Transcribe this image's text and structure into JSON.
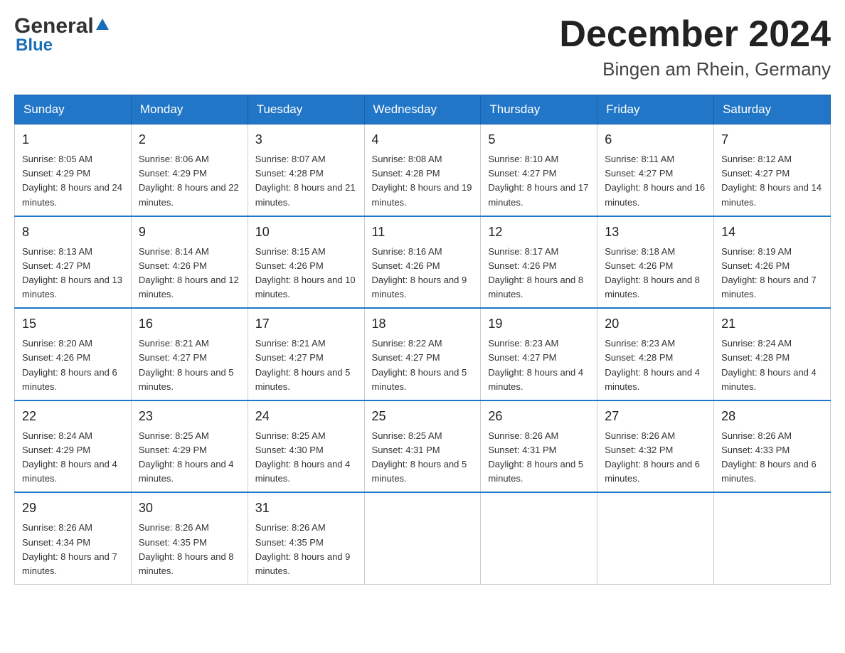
{
  "header": {
    "logo_general": "General",
    "logo_blue": "Blue",
    "title": "December 2024",
    "subtitle": "Bingen am Rhein, Germany"
  },
  "days_of_week": [
    "Sunday",
    "Monday",
    "Tuesday",
    "Wednesday",
    "Thursday",
    "Friday",
    "Saturday"
  ],
  "weeks": [
    [
      {
        "day": "1",
        "sunrise": "Sunrise: 8:05 AM",
        "sunset": "Sunset: 4:29 PM",
        "daylight": "Daylight: 8 hours and 24 minutes."
      },
      {
        "day": "2",
        "sunrise": "Sunrise: 8:06 AM",
        "sunset": "Sunset: 4:29 PM",
        "daylight": "Daylight: 8 hours and 22 minutes."
      },
      {
        "day": "3",
        "sunrise": "Sunrise: 8:07 AM",
        "sunset": "Sunset: 4:28 PM",
        "daylight": "Daylight: 8 hours and 21 minutes."
      },
      {
        "day": "4",
        "sunrise": "Sunrise: 8:08 AM",
        "sunset": "Sunset: 4:28 PM",
        "daylight": "Daylight: 8 hours and 19 minutes."
      },
      {
        "day": "5",
        "sunrise": "Sunrise: 8:10 AM",
        "sunset": "Sunset: 4:27 PM",
        "daylight": "Daylight: 8 hours and 17 minutes."
      },
      {
        "day": "6",
        "sunrise": "Sunrise: 8:11 AM",
        "sunset": "Sunset: 4:27 PM",
        "daylight": "Daylight: 8 hours and 16 minutes."
      },
      {
        "day": "7",
        "sunrise": "Sunrise: 8:12 AM",
        "sunset": "Sunset: 4:27 PM",
        "daylight": "Daylight: 8 hours and 14 minutes."
      }
    ],
    [
      {
        "day": "8",
        "sunrise": "Sunrise: 8:13 AM",
        "sunset": "Sunset: 4:27 PM",
        "daylight": "Daylight: 8 hours and 13 minutes."
      },
      {
        "day": "9",
        "sunrise": "Sunrise: 8:14 AM",
        "sunset": "Sunset: 4:26 PM",
        "daylight": "Daylight: 8 hours and 12 minutes."
      },
      {
        "day": "10",
        "sunrise": "Sunrise: 8:15 AM",
        "sunset": "Sunset: 4:26 PM",
        "daylight": "Daylight: 8 hours and 10 minutes."
      },
      {
        "day": "11",
        "sunrise": "Sunrise: 8:16 AM",
        "sunset": "Sunset: 4:26 PM",
        "daylight": "Daylight: 8 hours and 9 minutes."
      },
      {
        "day": "12",
        "sunrise": "Sunrise: 8:17 AM",
        "sunset": "Sunset: 4:26 PM",
        "daylight": "Daylight: 8 hours and 8 minutes."
      },
      {
        "day": "13",
        "sunrise": "Sunrise: 8:18 AM",
        "sunset": "Sunset: 4:26 PM",
        "daylight": "Daylight: 8 hours and 8 minutes."
      },
      {
        "day": "14",
        "sunrise": "Sunrise: 8:19 AM",
        "sunset": "Sunset: 4:26 PM",
        "daylight": "Daylight: 8 hours and 7 minutes."
      }
    ],
    [
      {
        "day": "15",
        "sunrise": "Sunrise: 8:20 AM",
        "sunset": "Sunset: 4:26 PM",
        "daylight": "Daylight: 8 hours and 6 minutes."
      },
      {
        "day": "16",
        "sunrise": "Sunrise: 8:21 AM",
        "sunset": "Sunset: 4:27 PM",
        "daylight": "Daylight: 8 hours and 5 minutes."
      },
      {
        "day": "17",
        "sunrise": "Sunrise: 8:21 AM",
        "sunset": "Sunset: 4:27 PM",
        "daylight": "Daylight: 8 hours and 5 minutes."
      },
      {
        "day": "18",
        "sunrise": "Sunrise: 8:22 AM",
        "sunset": "Sunset: 4:27 PM",
        "daylight": "Daylight: 8 hours and 5 minutes."
      },
      {
        "day": "19",
        "sunrise": "Sunrise: 8:23 AM",
        "sunset": "Sunset: 4:27 PM",
        "daylight": "Daylight: 8 hours and 4 minutes."
      },
      {
        "day": "20",
        "sunrise": "Sunrise: 8:23 AM",
        "sunset": "Sunset: 4:28 PM",
        "daylight": "Daylight: 8 hours and 4 minutes."
      },
      {
        "day": "21",
        "sunrise": "Sunrise: 8:24 AM",
        "sunset": "Sunset: 4:28 PM",
        "daylight": "Daylight: 8 hours and 4 minutes."
      }
    ],
    [
      {
        "day": "22",
        "sunrise": "Sunrise: 8:24 AM",
        "sunset": "Sunset: 4:29 PM",
        "daylight": "Daylight: 8 hours and 4 minutes."
      },
      {
        "day": "23",
        "sunrise": "Sunrise: 8:25 AM",
        "sunset": "Sunset: 4:29 PM",
        "daylight": "Daylight: 8 hours and 4 minutes."
      },
      {
        "day": "24",
        "sunrise": "Sunrise: 8:25 AM",
        "sunset": "Sunset: 4:30 PM",
        "daylight": "Daylight: 8 hours and 4 minutes."
      },
      {
        "day": "25",
        "sunrise": "Sunrise: 8:25 AM",
        "sunset": "Sunset: 4:31 PM",
        "daylight": "Daylight: 8 hours and 5 minutes."
      },
      {
        "day": "26",
        "sunrise": "Sunrise: 8:26 AM",
        "sunset": "Sunset: 4:31 PM",
        "daylight": "Daylight: 8 hours and 5 minutes."
      },
      {
        "day": "27",
        "sunrise": "Sunrise: 8:26 AM",
        "sunset": "Sunset: 4:32 PM",
        "daylight": "Daylight: 8 hours and 6 minutes."
      },
      {
        "day": "28",
        "sunrise": "Sunrise: 8:26 AM",
        "sunset": "Sunset: 4:33 PM",
        "daylight": "Daylight: 8 hours and 6 minutes."
      }
    ],
    [
      {
        "day": "29",
        "sunrise": "Sunrise: 8:26 AM",
        "sunset": "Sunset: 4:34 PM",
        "daylight": "Daylight: 8 hours and 7 minutes."
      },
      {
        "day": "30",
        "sunrise": "Sunrise: 8:26 AM",
        "sunset": "Sunset: 4:35 PM",
        "daylight": "Daylight: 8 hours and 8 minutes."
      },
      {
        "day": "31",
        "sunrise": "Sunrise: 8:26 AM",
        "sunset": "Sunset: 4:35 PM",
        "daylight": "Daylight: 8 hours and 9 minutes."
      },
      {
        "day": "",
        "sunrise": "",
        "sunset": "",
        "daylight": ""
      },
      {
        "day": "",
        "sunrise": "",
        "sunset": "",
        "daylight": ""
      },
      {
        "day": "",
        "sunrise": "",
        "sunset": "",
        "daylight": ""
      },
      {
        "day": "",
        "sunrise": "",
        "sunset": "",
        "daylight": ""
      }
    ]
  ]
}
